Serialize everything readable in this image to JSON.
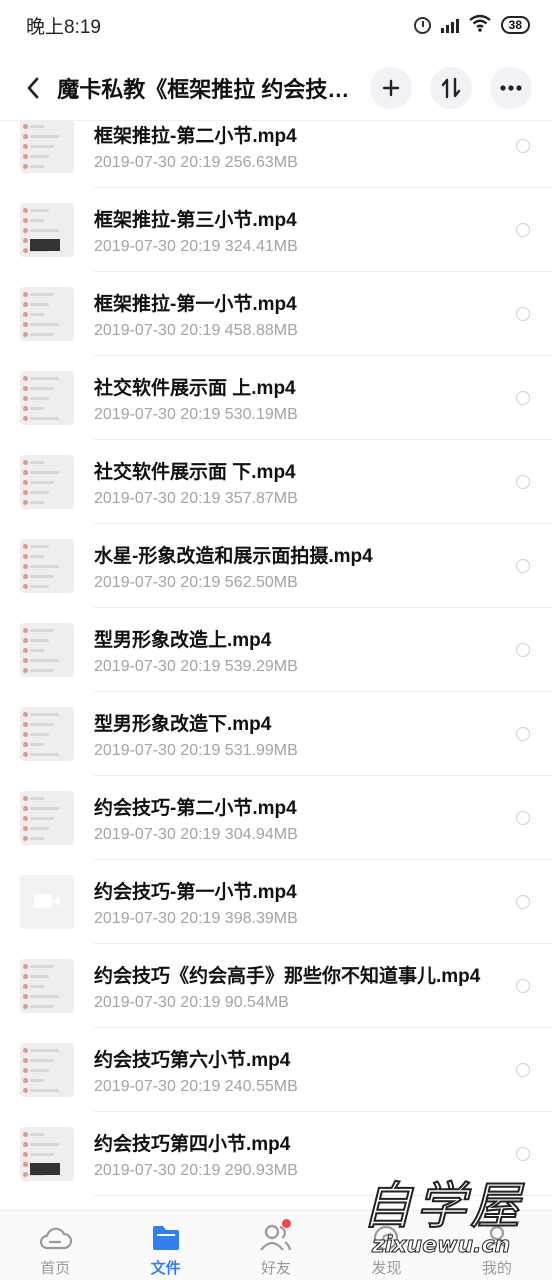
{
  "status_bar": {
    "time": "晚上8:19",
    "battery": "38",
    "icons": [
      "alarm-icon",
      "signal-icon",
      "wifi-icon",
      "battery-icon"
    ]
  },
  "header": {
    "title": "魔卡私教《框架推拉 约会技巧》",
    "back_icon": "chevron-left-icon",
    "add_icon": "plus-icon",
    "sort_icon": "sort-icon",
    "more_icon": "more-icon"
  },
  "files": [
    {
      "name": "框架推拉-第二小节.mp4",
      "date": "2019-07-30",
      "time": "20:19",
      "size": "256.63MB"
    },
    {
      "name": "框架推拉-第三小节.mp4",
      "date": "2019-07-30",
      "time": "20:19",
      "size": "324.41MB"
    },
    {
      "name": "框架推拉-第一小节.mp4",
      "date": "2019-07-30",
      "time": "20:19",
      "size": "458.88MB"
    },
    {
      "name": "社交软件展示面 上.mp4",
      "date": "2019-07-30",
      "time": "20:19",
      "size": "530.19MB"
    },
    {
      "name": "社交软件展示面 下.mp4",
      "date": "2019-07-30",
      "time": "20:19",
      "size": "357.87MB"
    },
    {
      "name": "水星-形象改造和展示面拍摄.mp4",
      "date": "2019-07-30",
      "time": "20:19",
      "size": "562.50MB"
    },
    {
      "name": "型男形象改造上.mp4",
      "date": "2019-07-30",
      "time": "20:19",
      "size": "539.29MB"
    },
    {
      "name": "型男形象改造下.mp4",
      "date": "2019-07-30",
      "time": "20:19",
      "size": "531.99MB"
    },
    {
      "name": "约会技巧-第二小节.mp4",
      "date": "2019-07-30",
      "time": "20:19",
      "size": "304.94MB"
    },
    {
      "name": "约会技巧-第一小节.mp4",
      "date": "2019-07-30",
      "time": "20:19",
      "size": "398.39MB"
    },
    {
      "name": "约会技巧《约会高手》那些你不知道事儿.mp4",
      "date": "2019-07-30",
      "time": "20:19",
      "size": "90.54MB"
    },
    {
      "name": "约会技巧第六小节.mp4",
      "date": "2019-07-30",
      "time": "20:19",
      "size": "240.55MB"
    },
    {
      "name": "约会技巧第四小节.mp4",
      "date": "2019-07-30",
      "time": "20:19",
      "size": "290.93MB"
    }
  ],
  "bottom_nav": [
    {
      "label": "首页",
      "icon": "cloud-icon",
      "active": false
    },
    {
      "label": "文件",
      "icon": "folder-icon",
      "active": true
    },
    {
      "label": "好友",
      "icon": "friends-icon",
      "active": false,
      "badge": true
    },
    {
      "label": "发现",
      "icon": "discover-icon",
      "active": false
    },
    {
      "label": "我的",
      "icon": "profile-icon",
      "active": false
    }
  ],
  "watermark": {
    "line1": "自学屋",
    "line2": "zixuewu.cn"
  },
  "colors": {
    "accent": "#2f7ff2",
    "badge": "#f04848",
    "meta_text": "#a3a3a3"
  }
}
